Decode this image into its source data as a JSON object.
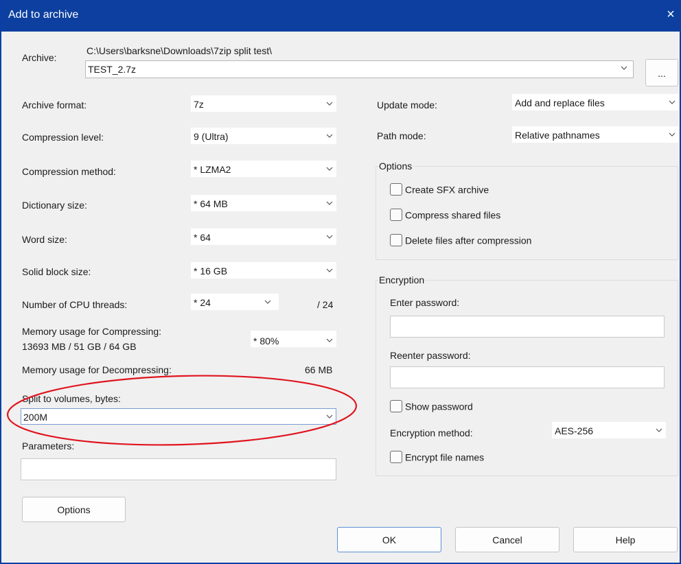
{
  "window": {
    "title": "Add to archive",
    "close_label": "×"
  },
  "archive": {
    "label": "Archive:",
    "path": "C:\\Users\\barksne\\Downloads\\7zip split test\\",
    "filename": "TEST_2.7z",
    "browse_label": "..."
  },
  "left": {
    "archive_format": {
      "label": "Archive format:",
      "value": "7z"
    },
    "compression_level": {
      "label": "Compression level:",
      "value": "9 (Ultra)"
    },
    "compression_method": {
      "label": "Compression method:",
      "value": "* LZMA2"
    },
    "dictionary_size": {
      "label": "Dictionary size:",
      "value": "* 64 MB"
    },
    "word_size": {
      "label": "Word size:",
      "value": "* 64"
    },
    "solid_block_size": {
      "label": "Solid block size:",
      "value": "* 16 GB"
    },
    "cpu_threads": {
      "label": "Number of CPU threads:",
      "value": "* 24",
      "max": "/ 24"
    },
    "memory_compress": {
      "label": "Memory usage for Compressing:",
      "detail": "13693 MB / 51 GB / 64 GB",
      "value": "* 80%"
    },
    "memory_decompress": {
      "label": "Memory usage for Decompressing:",
      "value": "66 MB"
    },
    "split_volumes": {
      "label": "Split to volumes, bytes:",
      "value": "200M"
    },
    "parameters": {
      "label": "Parameters:",
      "value": ""
    },
    "options_button": "Options"
  },
  "right": {
    "update_mode": {
      "label": "Update mode:",
      "value": "Add and replace files"
    },
    "path_mode": {
      "label": "Path mode:",
      "value": "Relative pathnames"
    },
    "options_group": {
      "title": "Options",
      "create_sfx": "Create SFX archive",
      "compress_shared": "Compress shared files",
      "delete_after": "Delete files after compression"
    },
    "encryption_group": {
      "title": "Encryption",
      "enter_password": "Enter password:",
      "reenter_password": "Reenter password:",
      "show_password": "Show password",
      "method_label": "Encryption method:",
      "method_value": "AES-256",
      "encrypt_names": "Encrypt file names"
    }
  },
  "buttons": {
    "ok": "OK",
    "cancel": "Cancel",
    "help": "Help"
  },
  "colors": {
    "titlebar": "#0c3f9f",
    "annotation": "#e0141e",
    "accent_border": "#5b8fd6"
  }
}
